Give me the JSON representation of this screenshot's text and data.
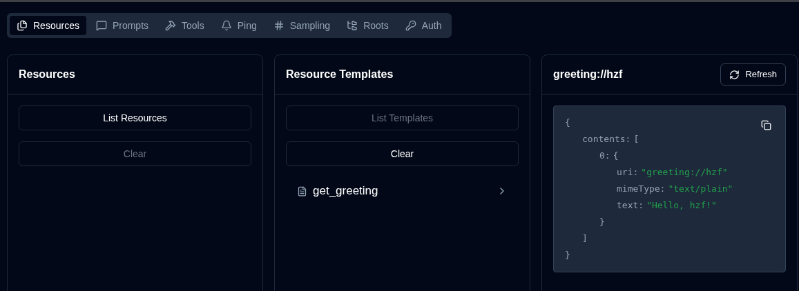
{
  "tabs": [
    {
      "label": "Resources",
      "selected": true
    },
    {
      "label": "Prompts",
      "selected": false
    },
    {
      "label": "Tools",
      "selected": false
    },
    {
      "label": "Ping",
      "selected": false
    },
    {
      "label": "Sampling",
      "selected": false
    },
    {
      "label": "Roots",
      "selected": false
    },
    {
      "label": "Auth",
      "selected": false
    }
  ],
  "resources": {
    "title": "Resources",
    "buttons": [
      {
        "label": "List Resources",
        "disabled": false
      },
      {
        "label": "Clear",
        "disabled": true
      }
    ]
  },
  "templates": {
    "title": "Resource Templates",
    "buttons": [
      {
        "label": "List Templates",
        "disabled": true
      },
      {
        "label": "Clear",
        "disabled": false
      }
    ],
    "items": [
      {
        "name": "get_greeting"
      }
    ]
  },
  "detail": {
    "title": "greeting://hzf",
    "refresh": "Refresh",
    "json": {
      "open": "{",
      "close": "}",
      "children": [
        {
          "key": "contents:",
          "open": "[",
          "close": "]",
          "children": [
            {
              "key": "0:",
              "open": "{",
              "close": "}",
              "children": [
                {
                  "key": "uri:",
                  "value": "\"greeting://hzf\""
                },
                {
                  "key": "mimeType:",
                  "value": "\"text/plain\""
                },
                {
                  "key": "text:",
                  "value": "\"Hello, hzf!\""
                }
              ]
            }
          ]
        }
      ]
    }
  }
}
